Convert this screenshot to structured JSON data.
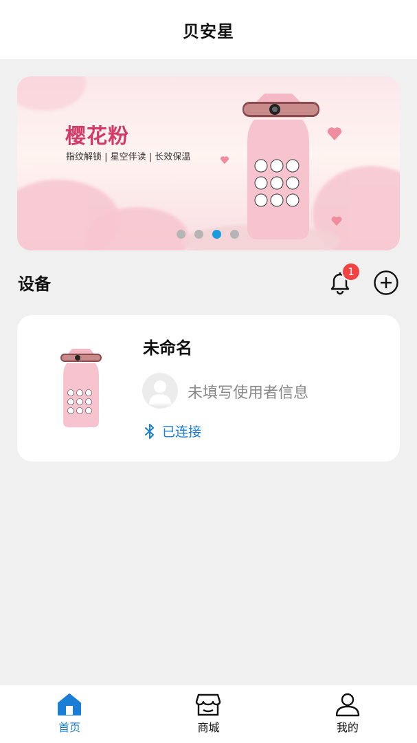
{
  "header": {
    "title": "贝安星"
  },
  "banner": {
    "title": "樱花粉",
    "subtitle": "指纹解锁 | 星空伴读 | 长效保温",
    "page_count": 4,
    "active_page": 3
  },
  "devices": {
    "section_title": "设备",
    "notification_count": "1",
    "items": [
      {
        "name": "未命名",
        "user_info": "未填写使用者信息",
        "status": "已连接"
      }
    ]
  },
  "tabs": [
    {
      "label": "首页",
      "icon": "home-icon",
      "active": true
    },
    {
      "label": "商城",
      "icon": "store-icon",
      "active": false
    },
    {
      "label": "我的",
      "icon": "profile-icon",
      "active": false
    }
  ],
  "colors": {
    "accent": "#1a7fd4",
    "badge": "#f04342",
    "banner_title": "#d23b68"
  }
}
